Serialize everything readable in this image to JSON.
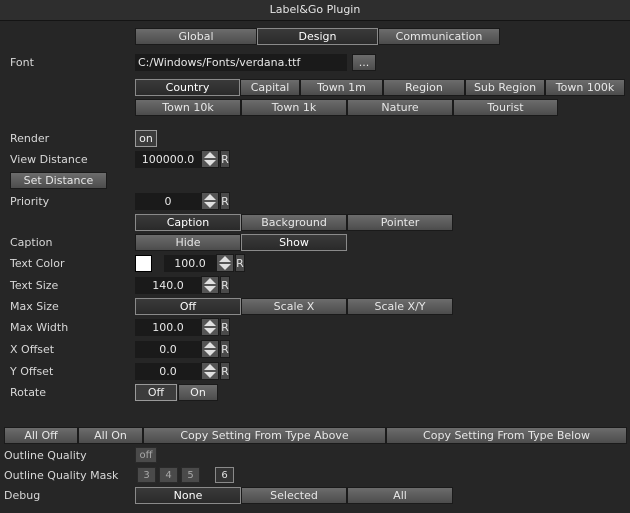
{
  "window": {
    "title": "Label&Go Plugin"
  },
  "tabs": [
    "Global",
    "Design",
    "Communication"
  ],
  "font": {
    "label": "Font",
    "path": "C:/Windows/Fonts/verdana.ttf",
    "browse": "..."
  },
  "types_row1": [
    "Country",
    "Capital",
    "Town 1m",
    "Region",
    "Sub Region",
    "Town 100k"
  ],
  "types_row2": [
    "Town 10k",
    "Town 1k",
    "Nature",
    "Tourist"
  ],
  "render": {
    "label": "Render",
    "value": "on"
  },
  "view_distance": {
    "label": "View Distance",
    "value": "100000.0",
    "reset": "R"
  },
  "set_distance": {
    "label": "Set Distance"
  },
  "priority": {
    "label": "Priority",
    "value": "0",
    "reset": "R"
  },
  "sections": [
    "Caption",
    "Background",
    "Pointer"
  ],
  "caption": {
    "label": "Caption",
    "hide": "Hide",
    "show": "Show"
  },
  "text_color": {
    "label": "Text Color",
    "value": "100.0",
    "reset": "R",
    "color": "#ffffff"
  },
  "text_size": {
    "label": "Text Size",
    "value": "140.0",
    "reset": "R"
  },
  "max_size": {
    "label": "Max Size",
    "options": [
      "Off",
      "Scale X",
      "Scale X/Y"
    ]
  },
  "max_width": {
    "label": "Max Width",
    "value": "100.0",
    "reset": "R"
  },
  "x_offset": {
    "label": "X Offset",
    "value": "0.0",
    "reset": "R"
  },
  "y_offset": {
    "label": "Y Offset",
    "value": "0.0",
    "reset": "R"
  },
  "rotate": {
    "label": "Rotate",
    "off": "Off",
    "on": "On"
  },
  "bottom_buttons": [
    "All Off",
    "All On",
    "Copy Setting From Type Above",
    "Copy Setting From Type Below"
  ],
  "outline_quality": {
    "label": "Outline Quality",
    "value": "off"
  },
  "outline_quality_mask": {
    "label": "Outline Quality Mask",
    "options": [
      "3",
      "4",
      "5",
      "6"
    ]
  },
  "debug": {
    "label": "Debug",
    "options": [
      "None",
      "Selected",
      "All"
    ]
  }
}
